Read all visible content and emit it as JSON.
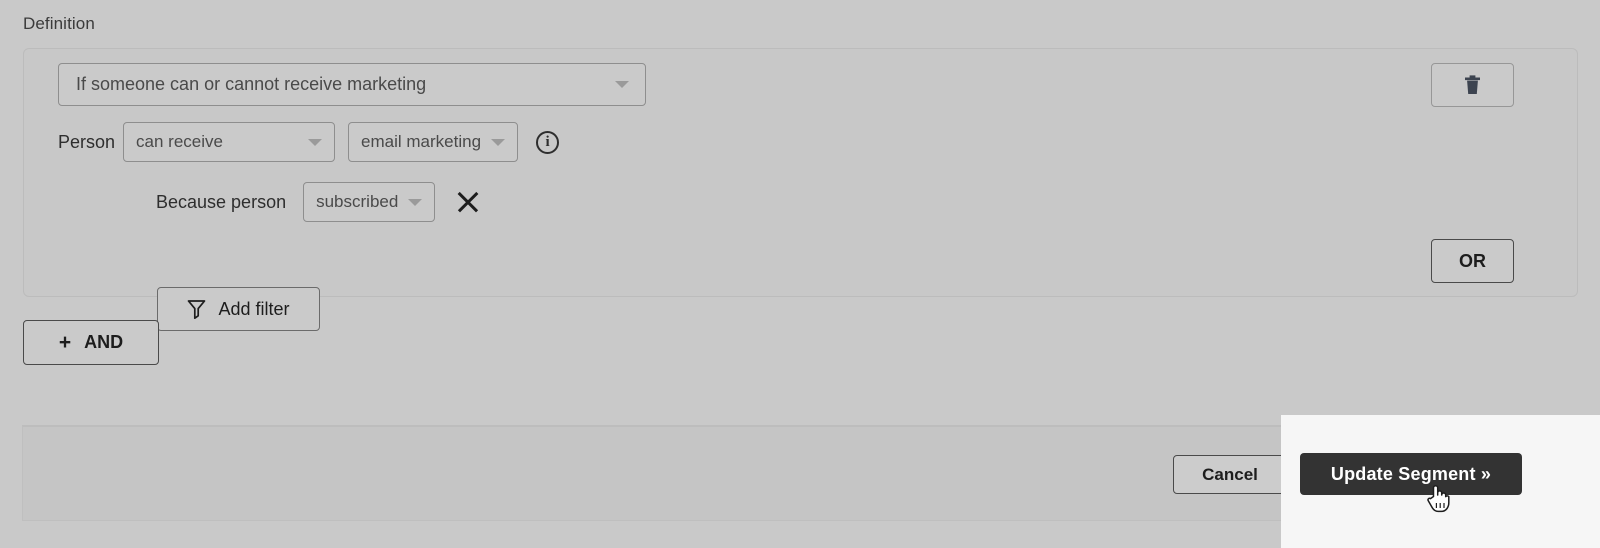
{
  "section": {
    "label": "Definition"
  },
  "definition": {
    "condition_select": {
      "value": "If someone can or cannot receive marketing",
      "icon": "chevron-down-icon"
    },
    "person_row": {
      "label": "Person",
      "operator_select": {
        "value": "can receive"
      },
      "channel_select": {
        "value": "email marketing"
      },
      "info_icon": "info-icon",
      "info_glyph": "i"
    },
    "because_row": {
      "label": "Because person",
      "reason_select": {
        "value": "subscribed"
      },
      "remove_icon": "close-icon"
    },
    "add_filter_button": {
      "label": "Add filter",
      "icon": "funnel-icon"
    },
    "delete_group_button": {
      "icon": "trash-icon",
      "label": ""
    },
    "or_button": {
      "label": "OR"
    }
  },
  "and_button": {
    "plus": "+",
    "label": "AND"
  },
  "footer": {
    "cancel_button": {
      "label": "Cancel"
    },
    "update_button": {
      "label": "Update Segment »"
    },
    "cursor": "pointer-hand-cursor"
  },
  "colors": {
    "page_background": "#c9c9c9",
    "panel_background": "#c8c8c8",
    "panel_border": "#bcbcbc",
    "select_background": "#cacaca",
    "select_border": "#8e8e8e",
    "button_border": "#4a4a4a",
    "text_primary": "#1d1d1d",
    "text_muted": "#4a4a4a",
    "footer_background": "#c5c5c5",
    "overlay_background": "#f6f6f6",
    "primary_button_background": "#333333",
    "primary_button_text": "#ffffff"
  }
}
